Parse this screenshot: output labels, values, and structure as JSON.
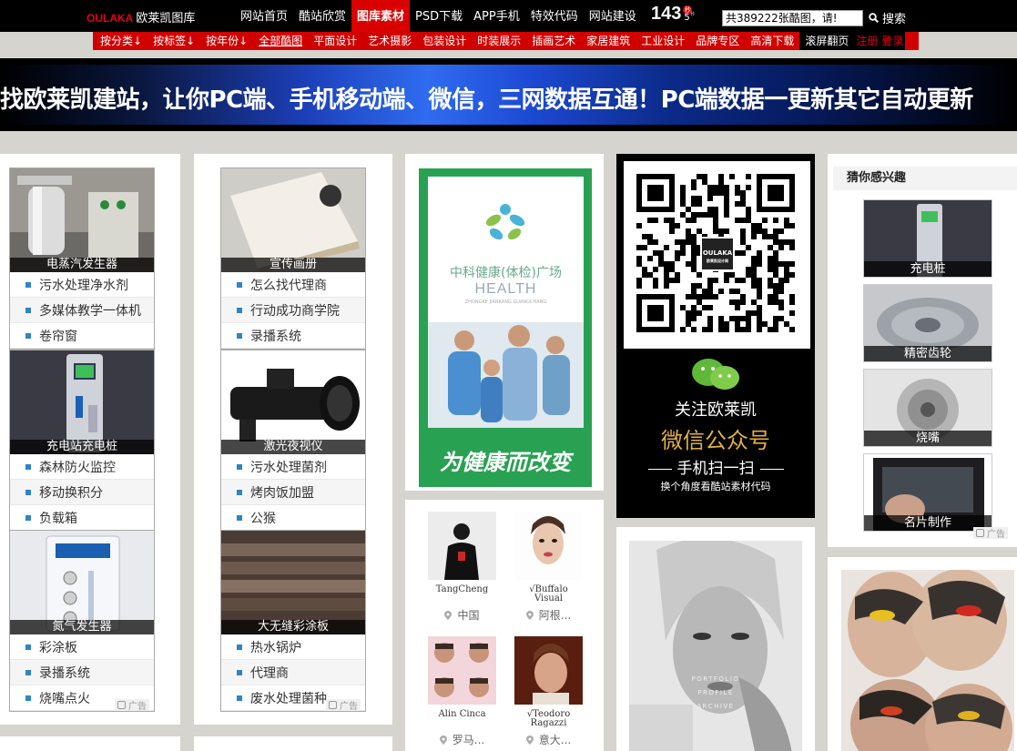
{
  "header": {
    "logo_brand": "OULAKA",
    "logo_text": "欧莱凯图库",
    "nav": [
      "网站首页",
      "酷站欣赏",
      "图库素材",
      "PSD下载",
      "APP手机",
      "特效代码",
      "网站建设"
    ],
    "nav_active_index": 2,
    "counter": "143",
    "counter_badge": "秒",
    "counter_small": "5",
    "counter_tiny": "秒",
    "search_value": "共389222张酷图，请!",
    "search_label": "搜索"
  },
  "subnav": {
    "items": [
      "按分类↓",
      "按标签↓",
      "按年份↓",
      "全部酷图",
      "平面设计",
      "艺术摄影",
      "包装设计",
      "时装展示",
      "插画艺术",
      "家居建筑",
      "工业设计",
      "品牌专区",
      "高清下载"
    ],
    "underline_index": 3,
    "scroll_label": "滚屏翻页",
    "register": "注册",
    "login": "登录"
  },
  "banner": {
    "text": "找欧莱凯建站，让你PC端、手机移动端、微信，三网数据互通！PC端数据一更新其它自动更新"
  },
  "col1": {
    "groups": [
      {
        "caption": "电蒸汽发生器",
        "links": [
          "污水处理净水剂",
          "多媒体教学一体机",
          "卷帘窗"
        ]
      },
      {
        "caption": "充电站充电桩",
        "links": [
          "森林防火监控",
          "移动换积分",
          "负载箱"
        ]
      },
      {
        "caption": "氮气发生器",
        "links": [
          "彩涂板",
          "录播系统",
          "烧嘴点火"
        ]
      }
    ],
    "ad_label": "广告"
  },
  "col2": {
    "groups": [
      {
        "caption": "宣传画册",
        "links": [
          "怎么找代理商",
          "行动成功商学院",
          "录播系统"
        ]
      },
      {
        "caption": "激光夜视仪",
        "links": [
          "污水处理菌剂",
          "烤肉饭加盟",
          "公猴"
        ]
      },
      {
        "caption": "大无缝彩涂板",
        "links": [
          "热水锅炉",
          "代理商",
          "废水处理菌种"
        ]
      }
    ],
    "ad_label": "广告"
  },
  "col3": {
    "health_title": "中科健康(体检)广场",
    "health_sub": "HEALTH",
    "health_tiny": "ZHONGKE JIANKANG GUANGCHANG",
    "health_slogan": "为健康而改变",
    "people": [
      {
        "name": "TangCheng",
        "location": "中国"
      },
      {
        "name": "√Buffalo Visual",
        "location": "阿根..."
      },
      {
        "name": "Alin Cinca",
        "location": "罗马..."
      },
      {
        "name": "√Teodoro Ragazzi",
        "location": "意大..."
      }
    ]
  },
  "col4": {
    "qr_logo": "OULAKA",
    "qr_logo_sub": "欧莱凯设计网",
    "follow": "关注欧莱凯",
    "wechat": "微信公众号",
    "scan": "手机扫一扫",
    "tagline": "换个角度看酷站素材代码",
    "portfolio_lines": [
      "PORTFOLIO",
      "PROFILE",
      "ARCHIVE"
    ]
  },
  "col5": {
    "title": "猜你感兴趣",
    "items": [
      "充电桩",
      "精密齿轮",
      "烧嘴",
      "名片制作"
    ],
    "ad_label": "广告"
  }
}
